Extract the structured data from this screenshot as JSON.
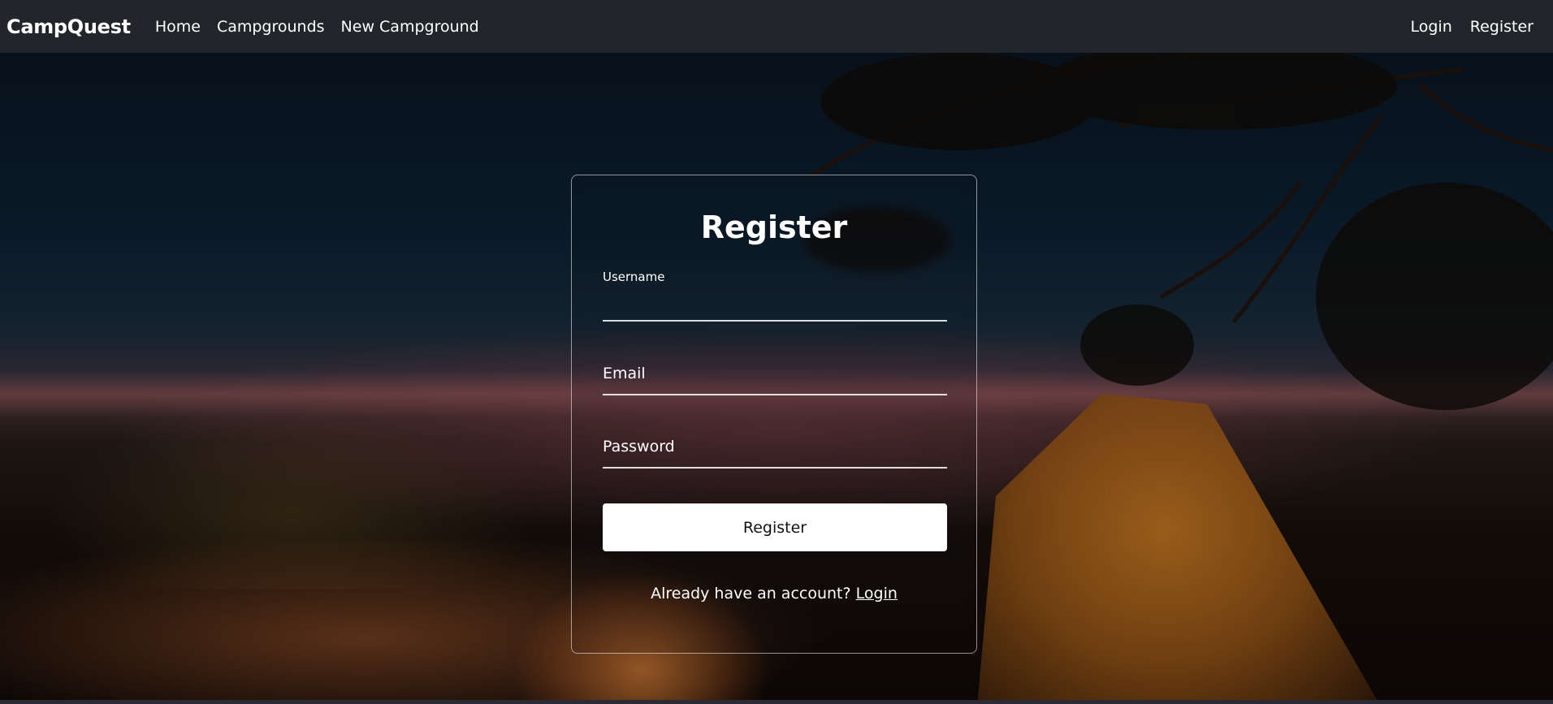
{
  "navbar": {
    "brand": "CampQuest",
    "links": [
      {
        "label": "Home"
      },
      {
        "label": "Campgrounds"
      },
      {
        "label": "New Campground"
      }
    ],
    "auth": {
      "login": "Login",
      "register": "Register"
    }
  },
  "form": {
    "title": "Register",
    "username_label": "Username",
    "username_value": "",
    "email_placeholder": "Email",
    "password_placeholder": "Password",
    "submit_label": "Register",
    "already_text": "Already have an account?",
    "login_link": "Login"
  },
  "colors": {
    "navbar_bg": "#22262b",
    "button_bg": "#ffffff",
    "text": "#ffffff"
  }
}
